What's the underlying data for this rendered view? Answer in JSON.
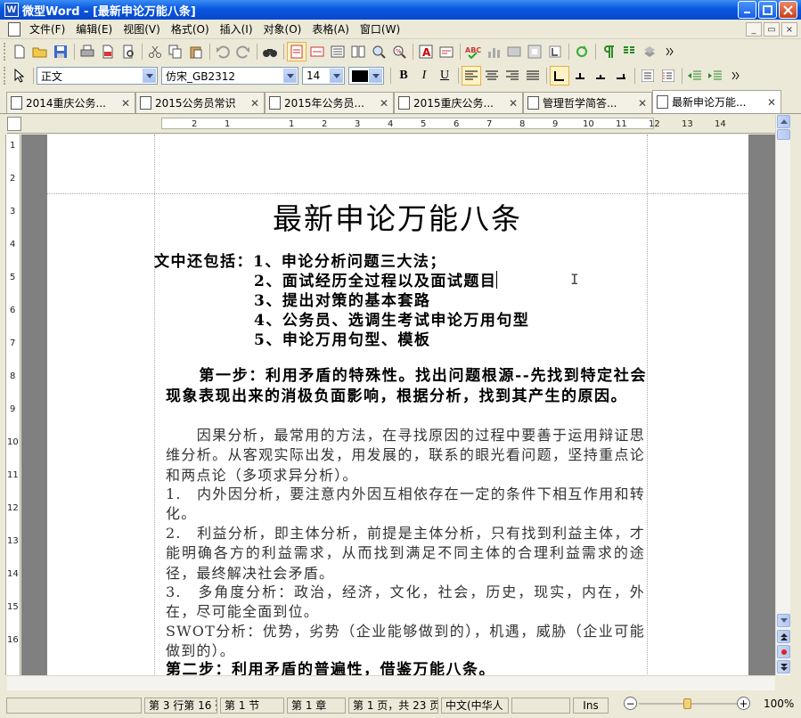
{
  "window": {
    "app_badge": "W",
    "title": "微型Word - [最新申论万能八条]"
  },
  "menubar": {
    "items": [
      "文件(F)",
      "编辑(E)",
      "视图(V)",
      "格式(O)",
      "插入(I)",
      "对象(O)",
      "表格(A)",
      "窗口(W)"
    ]
  },
  "mdi_buttons": [
    "_",
    "▭",
    "×"
  ],
  "format_toolbar": {
    "style": "正文",
    "font": "仿宋_GB2312",
    "size": "14",
    "bold": "B",
    "italic": "I",
    "underline": "U"
  },
  "tabs": [
    {
      "label": "2014重庆公务..."
    },
    {
      "label": "2015公务员常识"
    },
    {
      "label": "2015年公务员..."
    },
    {
      "label": "2015重庆公务..."
    },
    {
      "label": "管理哲学简答..."
    },
    {
      "label": "最新申论万能..."
    }
  ],
  "ruler": {
    "h_ticks": [
      "2",
      "1",
      "",
      "1",
      "2",
      "3",
      "4",
      "5",
      "6",
      "7",
      "8",
      "9",
      "10",
      "11",
      "12",
      "13",
      "14"
    ],
    "v_ticks": [
      "1",
      "2",
      "3",
      "4",
      "5",
      "6",
      "7",
      "8",
      "9",
      "10",
      "11",
      "12",
      "13",
      "14",
      "15",
      "16"
    ]
  },
  "document": {
    "title": "最新申论万能八条",
    "toc_intro": "文中还包括：1、申论分析问题三大法；",
    "toc_items": [
      "2、面试经历全过程以及面试题目",
      "3、提出对策的基本套路",
      "4、公务员、选调生考试申论万用句型",
      "5、申论万用句型、模板"
    ],
    "step1_heading": "　　第一步：利用矛盾的特殊性。找出问题根源--先找到特定社会现象表现出来的消极负面影响，根据分析，找到其产生的原因。",
    "paragraphs": [
      "　　因果分析，最常用的方法，在寻找原因的过程中要善于运用辩证思维分析。从客观实际出发，用发展的，联系的眼光看问题，坚持重点论和两点论（多项求异分析）。",
      "1.　内外因分析，要注意内外因互相依存在一定的条件下相互作用和转化。",
      "2.　利益分析，即主体分析，前提是主体分析，只有找到利益主体，才能明确各方的利益需求，从而找到满足不同主体的合理利益需求的途径，最终解决社会矛盾。",
      "3.　多角度分析：政治，经济，文化，社会，历史，现实，内在，外在，尽可能全面到位。",
      "SWOT分析：优势，劣势（企业能够做到的），机遇，威胁（企业可能做到的）。"
    ],
    "step2_heading": "第二步：利用矛盾的普遍性，借鉴万能八条。"
  },
  "statusbar": {
    "position": "第 3 行第 16 列",
    "section": "第 1 节",
    "chapter": "第 1 章",
    "page": "第 1 页，共 23 页",
    "language": "中文(中华人",
    "mode": "Ins",
    "zoom": "100%",
    "zoom_level": 1.0
  },
  "colors": {
    "title_blue": "#0a58e0",
    "bg": "#ece9d8",
    "doc_bg": "#808080"
  }
}
